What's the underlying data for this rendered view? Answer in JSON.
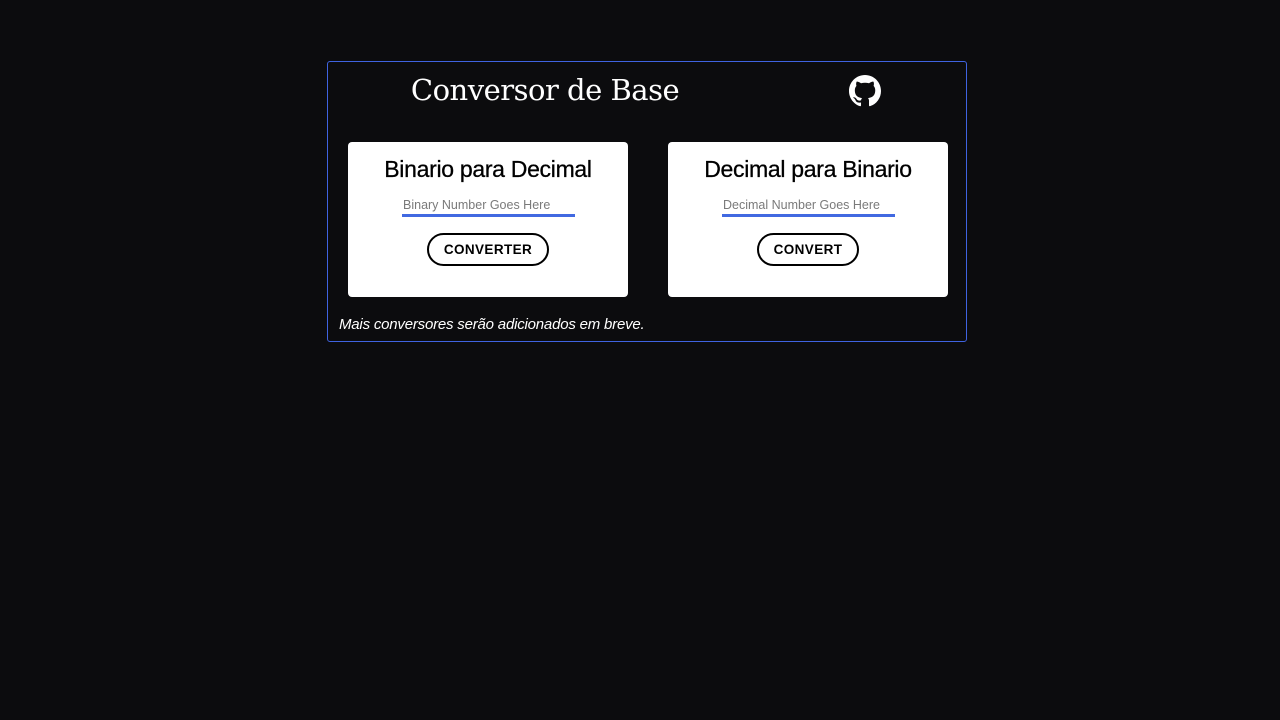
{
  "page": {
    "title": "Conversor de Base",
    "footer_note": "Mais conversores serão adicionados em breve."
  },
  "icons": {
    "github": "github-icon"
  },
  "converters": [
    {
      "heading": "Binario para Decimal",
      "input_placeholder": "Binary Number Goes Here",
      "input_value": "",
      "button_label": "CONVERTER"
    },
    {
      "heading": "Decimal para Binario",
      "input_placeholder": "Decimal Number Goes Here",
      "input_value": "",
      "button_label": "CONVERT"
    }
  ],
  "colors": {
    "background": "#0c0c0e",
    "accent": "#4169e1",
    "panel_border": "#3f63e0",
    "card": "#ffffff"
  }
}
